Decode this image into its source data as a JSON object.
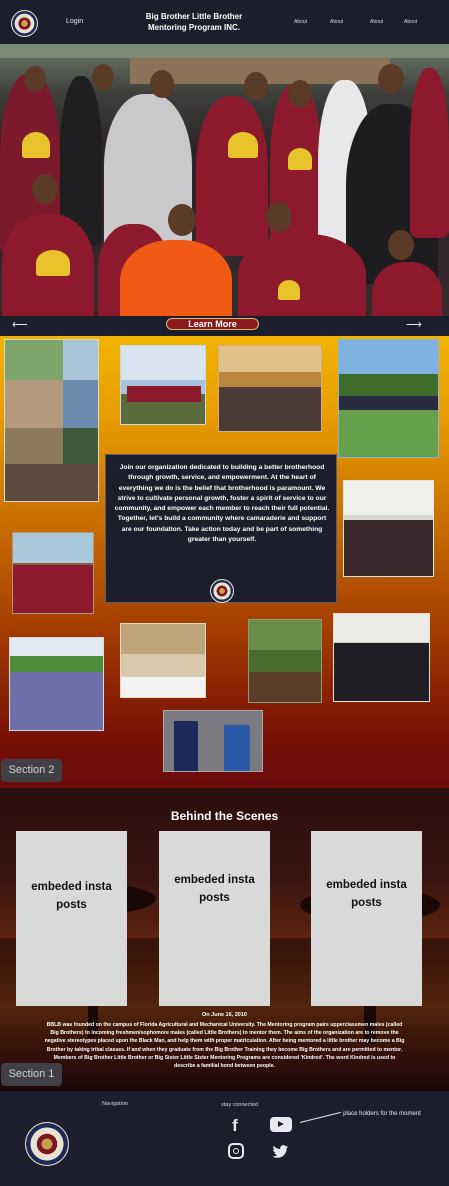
{
  "header": {
    "login_label": "Login",
    "brand_line1": "Big Brother Little Brother",
    "brand_line2": "Mentoring Program INC.",
    "nav": [
      "About",
      "About",
      "About",
      "About"
    ]
  },
  "hero": {
    "learn_more_label": "Learn More",
    "prev_arrow": "⟵",
    "next_arrow": "⟶"
  },
  "mission": {
    "text": "Join our organization dedicated to building a better brotherhood through growth, service, and empowerment. At the heart of everything we do is the belief that brotherhood is paramount. We strive to cultivate personal growth, foster a spirit of service to our community, and empower each member to reach their full potential. Together, let's build a community where camaraderie and support are our foundation. Take action today and be part of something greater than yourself."
  },
  "sections": {
    "section2_label": "Section 2",
    "section1_label": "Section 1"
  },
  "scenes": {
    "title": "Behind the Scenes",
    "embed_label": "embeded insta posts",
    "embeds": [
      "embeded insta posts",
      "embeded insta posts",
      "embeded insta posts"
    ]
  },
  "history": {
    "date": "On June 16, 2010",
    "text": "BBLB was founded on the campus of Florida Agricultural and Mechanical University.  The Mentoring program pairs upperclassmen males (called Big Brothers) to incoming freshmen/sophomore males (called Little Brothers) to mentor them. The aims of the organization are to remove the negative stereotypes placed upon the Black Man, and help them with proper matriculation. After being mentored a little brother may become a Big Brother by taking tribal classes. If and when they graduate from the Big Brother Training  they become Big Brothers and are permitted to mentor. Members of Big Brother Little Brother or Big Sister Little Sister Mentoring Programs are considered 'Kindred'. The word Kindred is used to describe a familial bond between people."
  },
  "footer": {
    "navigation_label": "Navigation",
    "stay_connected_label": "stay connected",
    "placeholder_note": "place holders for the moment",
    "icons": [
      "facebook-icon",
      "youtube-icon",
      "instagram-icon",
      "twitter-icon"
    ]
  },
  "colors": {
    "navy": "#1c1e2e",
    "maroon": "#8a1a1c",
    "gold": "#f2b400",
    "button_border": "#d9c06a"
  }
}
